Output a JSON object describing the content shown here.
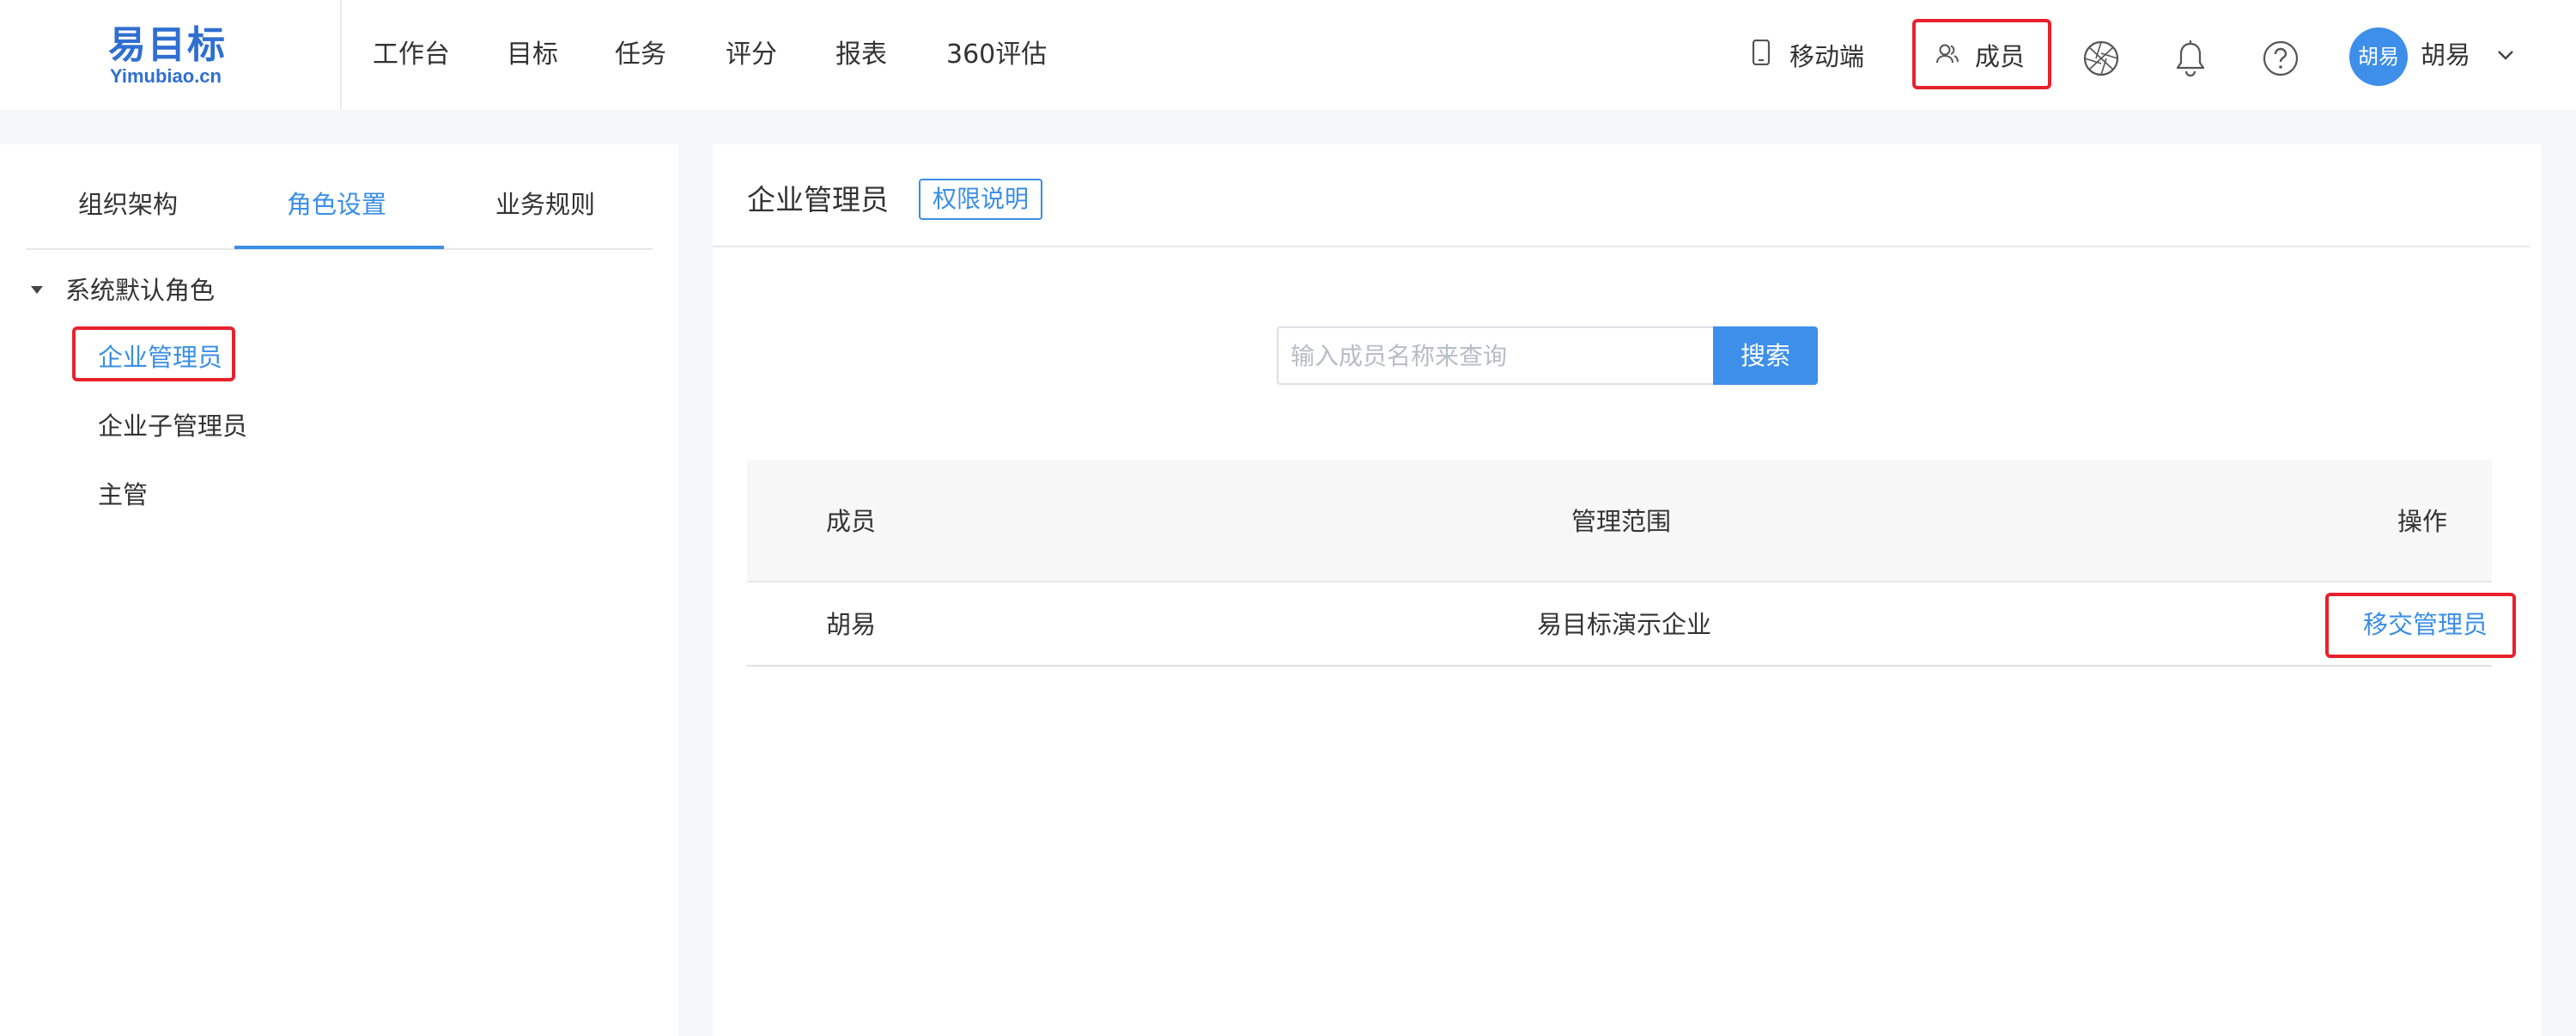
{
  "logo": {
    "cn": "易目标",
    "en": "Yimubiao.cn"
  },
  "nav": [
    {
      "label": "工作台"
    },
    {
      "label": "目标"
    },
    {
      "label": "任务"
    },
    {
      "label": "评分"
    },
    {
      "label": "报表"
    },
    {
      "label": "360评估"
    }
  ],
  "topright": {
    "mobile_label": "移动端",
    "members_label": "成员",
    "avatar_text": "胡易",
    "user_name": "胡易"
  },
  "left": {
    "tabs": [
      {
        "label": "组织架构"
      },
      {
        "label": "角色设置"
      },
      {
        "label": "业务规则"
      }
    ],
    "active_tab": "角色设置",
    "tree_root": "系统默认角色",
    "roles": [
      {
        "label": "企业管理员"
      },
      {
        "label": "企业子管理员"
      },
      {
        "label": "主管"
      }
    ],
    "active_role": "企业管理员"
  },
  "main": {
    "title": "企业管理员",
    "permission_button": "权限说明",
    "search": {
      "placeholder": "输入成员名称来查询",
      "value": "",
      "button": "搜索"
    },
    "table": {
      "headers": [
        "成员",
        "管理范围",
        "操作"
      ],
      "rows": [
        {
          "member": "胡易",
          "scope": "易目标演示企业",
          "action": "移交管理员"
        }
      ]
    }
  },
  "colors": {
    "accent": "#3a8ee6",
    "highlight": "#e8212b",
    "logo": "#2f6fd1"
  },
  "icons": [
    "mobile-icon",
    "members-icon",
    "aperture-icon",
    "bell-icon",
    "help-icon",
    "chevron-down-icon",
    "caret-down-icon"
  ]
}
